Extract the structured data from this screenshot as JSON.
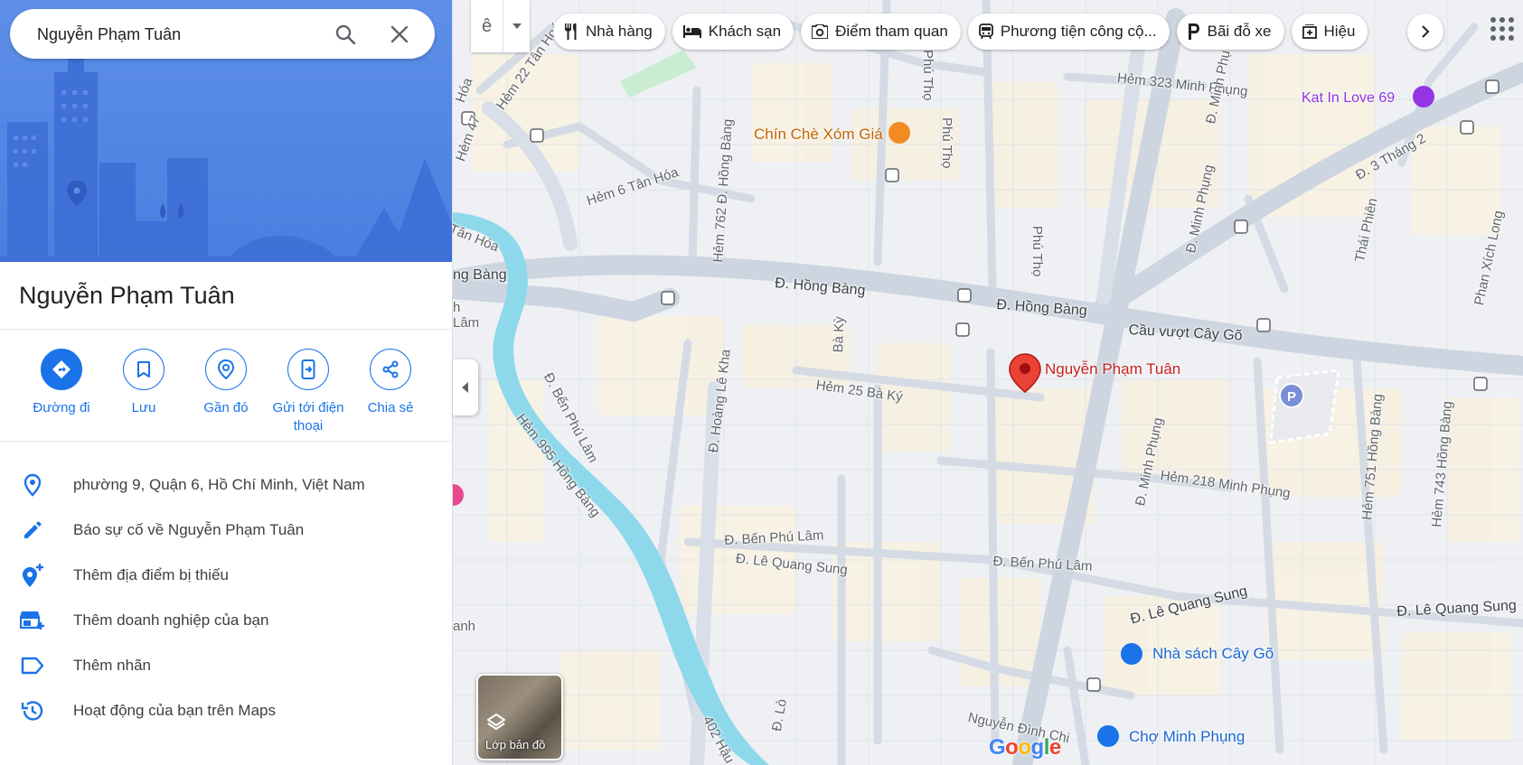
{
  "search": {
    "value": "Nguyễn Phạm Tuân"
  },
  "place": {
    "title": "Nguyễn Phạm Tuân"
  },
  "actions": [
    {
      "label": "Đường đi",
      "icon": "directions-icon"
    },
    {
      "label": "Lưu",
      "icon": "bookmark-icon"
    },
    {
      "label": "Gần đó",
      "icon": "nearby-icon"
    },
    {
      "label": "Gửi tới điện thoại",
      "icon": "send-to-phone-icon"
    },
    {
      "label": "Chia sẻ",
      "icon": "share-icon"
    }
  ],
  "info": [
    {
      "text": "phường 9, Quận 6, Hồ Chí Minh, Việt Nam",
      "icon": "location-pin-icon"
    },
    {
      "text": "Báo sự cố về Nguyễn Phạm Tuân",
      "icon": "pencil-icon"
    },
    {
      "text": "Thêm địa điểm bị thiếu",
      "icon": "add-location-icon"
    },
    {
      "text": "Thêm doanh nghiệp của bạn",
      "icon": "add-business-icon"
    },
    {
      "text": "Thêm nhãn",
      "icon": "label-icon"
    },
    {
      "text": "Hoạt động của bạn trên Maps",
      "icon": "history-icon"
    }
  ],
  "input_tool": {
    "label": "ê"
  },
  "chips": [
    {
      "label": "Nhà hàng",
      "icon": "restaurant-icon"
    },
    {
      "label": "Khách sạn",
      "icon": "hotel-icon"
    },
    {
      "label": "Điểm tham quan",
      "icon": "camera-icon"
    },
    {
      "label": "Phương tiện công cộ...",
      "icon": "transit-icon"
    },
    {
      "label": "Bãi đỗ xe",
      "icon": "parking-icon"
    },
    {
      "label": "Hiệu",
      "icon": "pharmacy-icon"
    }
  ],
  "map": {
    "pin_label": "Nguyễn Phạm Tuân",
    "layers_label": "Lớp bản đồ",
    "logo": "Google",
    "pois": {
      "restaurant": "Chín Chè Xóm Giá",
      "cafe": "Kat In Love 69",
      "bookstore": "Nhà sách Cây Gõ",
      "market": "Chợ Minh Phụng"
    },
    "streets": {
      "hong_bang_1": "Đ. Hồng Bàng",
      "hong_bang_2": "Đ. Hồng Bàng",
      "cau_vuot": "Cầu vượt Cây Gõ",
      "hem_323": "Hẻm 323 Minh Phụng",
      "minh_phung_top": "Đ. Minh Phụ",
      "minh_phung_mid": "Đ. Minh Phụng",
      "minh_phung_low": "Đ. Minh Phụng",
      "phu_tho_top": "Phú Thọ",
      "phu_tho_mid": "Phú Thọ",
      "phu_tho_small": "Phú Thọ",
      "ba_thang_hai": "Đ. 3 Tháng 2",
      "thai_phien": "Thái Phiên",
      "phan_xich_long": "Phan Xích Long",
      "hem_22": "Hẻm 22 Tân Hoá",
      "hem_47": "Hẻm 47",
      "hem_6": "Hẻm 6 Tân Hóa",
      "hem_762": "Hẻm 762 Đ. Hồng Bàng",
      "tan_hoa": "Tân Hóa",
      "hoa": "Hóa",
      "hong_bang_left": "ng Bàng",
      "lam": "Lâm",
      "h": "h",
      "hoang_le_kha": "Đ. Hoàng Lê Kha",
      "ba_ky": "Bà Kỳ",
      "hem_25": "Hẻm 25 Bà Ký",
      "ben_phu_lam_diag": "Đ. Bến Phú Lâm",
      "hem_995": "Hẻm 995 Hồng Bàng",
      "ben_phu_lam_1": "Đ. Bến Phú Lâm",
      "le_quang_sung_1": "Đ. Lê Quang Sung",
      "ben_phu_lam_2": "Đ. Bến Phú Lâm",
      "le_quang_sung_2": "Đ. Lê Quang Sung",
      "le_quang_sung_3": "Đ. Lê Quang Sung",
      "hem_218": "Hẻm 218 Minh Phụng",
      "hem_751": "Hẻm 751 Hồng Bàng",
      "hem_743": "Hẻm 743 Hồng Bàng",
      "nguyen_dinh_chi": "Nguyễn Đình Chi",
      "hem_402": "402 Hậu",
      "d_lo": "Đ. Lò",
      "anh": "anh"
    }
  },
  "colors": {
    "accent": "#1a73e8",
    "pin": "#ea4335",
    "poi_orange": "#e37400",
    "poi_purple": "#9334e6",
    "poi_blue": "#1a73e8",
    "river": "#8ed8ec",
    "road": "#d4dbe4"
  }
}
